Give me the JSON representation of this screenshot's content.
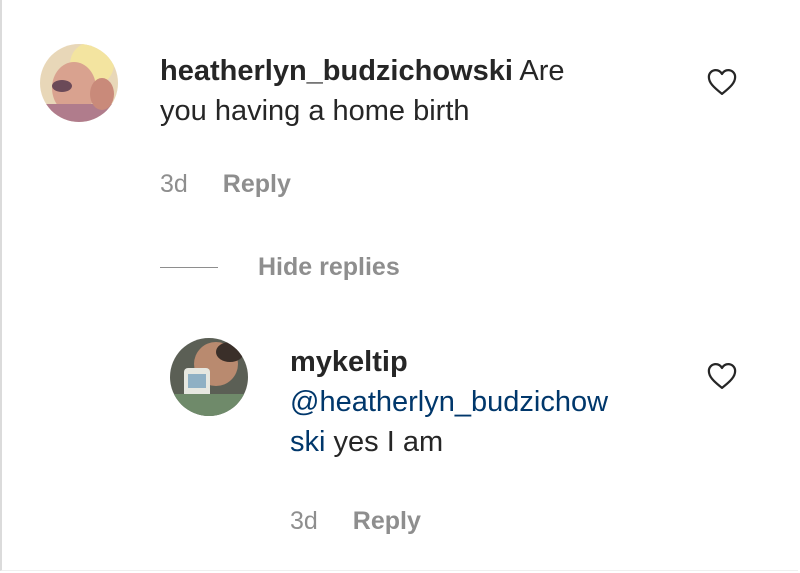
{
  "comment": {
    "username": "heatherlyn_budzichowski",
    "text_line1": "Are",
    "text_line2": "you having a home birth",
    "time": "3d",
    "reply_label": "Reply",
    "like_icon": "heart-outline-icon"
  },
  "replies_toggle": {
    "label": "Hide replies"
  },
  "reply": {
    "username": "mykeltip",
    "mention_line1": "@heatherlyn_budzichow",
    "mention_line2": "ski",
    "text": "yes I am",
    "time": "3d",
    "reply_label": "Reply",
    "like_icon": "heart-outline-icon"
  },
  "colors": {
    "text": "#262626",
    "secondary": "#8e8e8e",
    "mention": "#00376b"
  }
}
